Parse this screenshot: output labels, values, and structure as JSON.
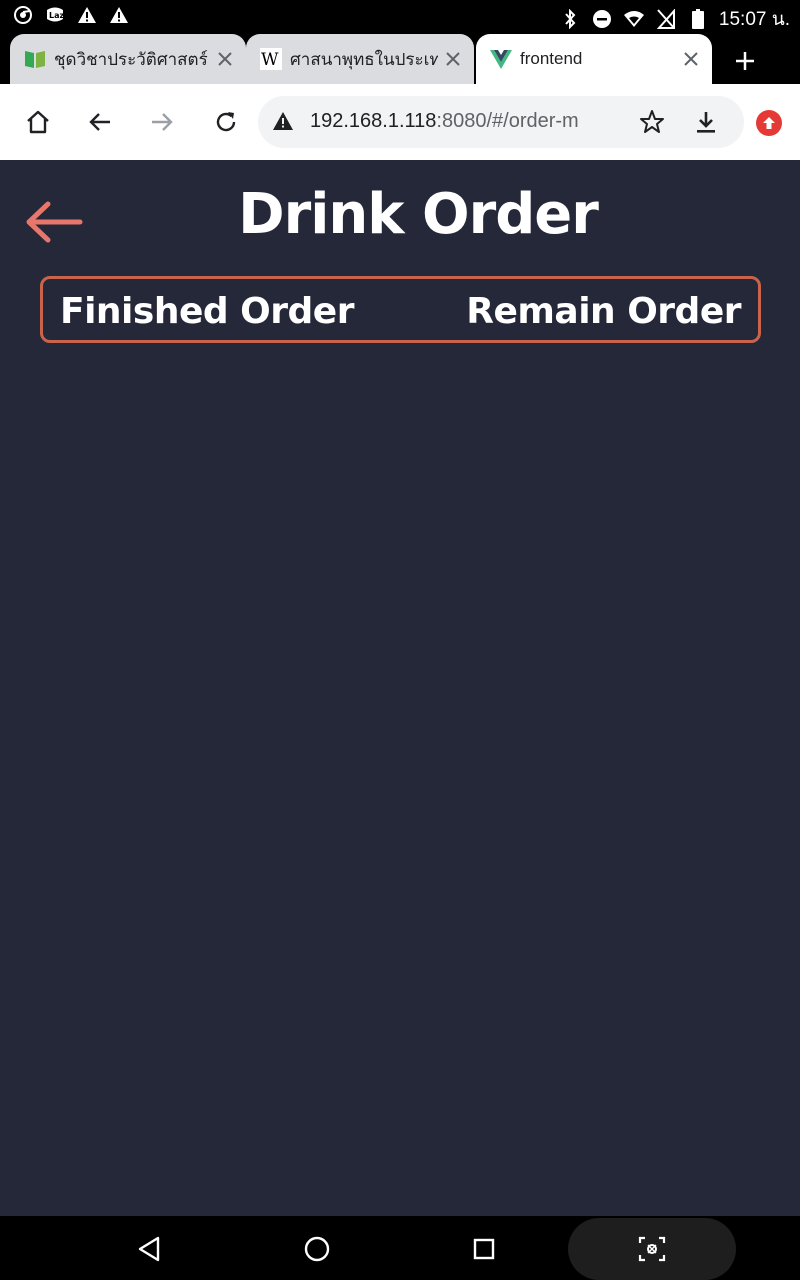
{
  "status_bar": {
    "time": "15:07 น.",
    "left_icons": [
      "chrome-icon",
      "lazada-icon",
      "warning-icon",
      "warning-icon"
    ],
    "right_icons": [
      "bluetooth-icon",
      "do-not-disturb-icon",
      "wifi-icon",
      "no-sim-icon",
      "battery-icon"
    ]
  },
  "tabs": [
    {
      "title": "ชุดวิชาประวัติศาสตร์",
      "favicon": "book-icon",
      "active": false
    },
    {
      "title": "ศาสนาพุทธในประเทศ",
      "favicon": "wikipedia-icon",
      "active": false
    },
    {
      "title": "frontend",
      "favicon": "vue-icon",
      "active": true
    }
  ],
  "toolbar": {
    "url_host": "192.168.1.118",
    "url_rest": ":8080/#/order-m"
  },
  "page": {
    "title": "Drink Order",
    "finished_label": "Finished Order",
    "remain_label": "Remain Order"
  },
  "colors": {
    "page_background": "#252838",
    "accent": "#c9634c",
    "back_arrow": "#e7776b"
  }
}
